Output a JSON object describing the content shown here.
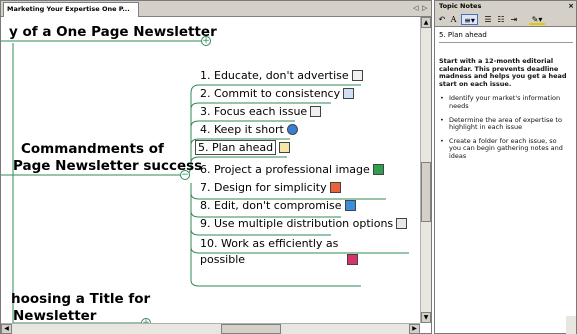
{
  "document": {
    "tab_title": "Marketing Your Expertise One P...",
    "tab_arrow_left": "◁",
    "tab_arrow_right": "▷"
  },
  "map": {
    "top_heading": "y of a One Page Newsletter",
    "central_topic_line1": "Commandments of",
    "central_topic_line2": "Page Newsletter success",
    "bottom_heading_line1": "hoosing a Title for",
    "bottom_heading_line2": "Newsletter",
    "expand_symbol": "+",
    "collapse_symbol": "−",
    "topics": [
      {
        "label": "1. Educate, don't advertise",
        "icon": "document-icon",
        "selected": false
      },
      {
        "label": "2. Commit to consistency",
        "icon": "calendar-icon",
        "selected": false
      },
      {
        "label": "3. Focus each issue",
        "icon": "document-icon",
        "selected": false
      },
      {
        "label": "4. Keep it short",
        "icon": "browser-globe-icon",
        "selected": false
      },
      {
        "label": "5. Plan ahead",
        "icon": "notepad-pencil-icon",
        "selected": true
      },
      {
        "label": "6. Project a professional image",
        "icon": "spreadsheet-icon",
        "selected": false
      },
      {
        "label": "7. Design for simplicity",
        "icon": "presentation-icon",
        "selected": false
      },
      {
        "label": "8. Edit, don't compromise",
        "icon": "share-icon",
        "selected": false
      },
      {
        "label": "9. Use multiple distribution options",
        "icon": "list-icon",
        "selected": false
      },
      {
        "label_line1": "10. Work as efficiently as",
        "label_line2": "possible",
        "icon": "pdf-icon",
        "selected": false
      }
    ]
  },
  "notes": {
    "pane_title": "Topic Notes",
    "close": "×",
    "topic_title": "5. Plan ahead",
    "intro": "Start with a 12-month editorial calendar. This prevents deadline madness and helps you get a head start on each issue.",
    "bullet": "•",
    "bullets": [
      "Identify your market's information needs",
      "Determine the area of expertise to highlight in each issue",
      "Create a folder for each issue, so you can begin gathering notes and ideas"
    ],
    "toolbar": {
      "font_label": "A"
    }
  },
  "colors": {
    "branch_green": "#2e8b57",
    "chrome_gray": "#d4d0c8"
  }
}
